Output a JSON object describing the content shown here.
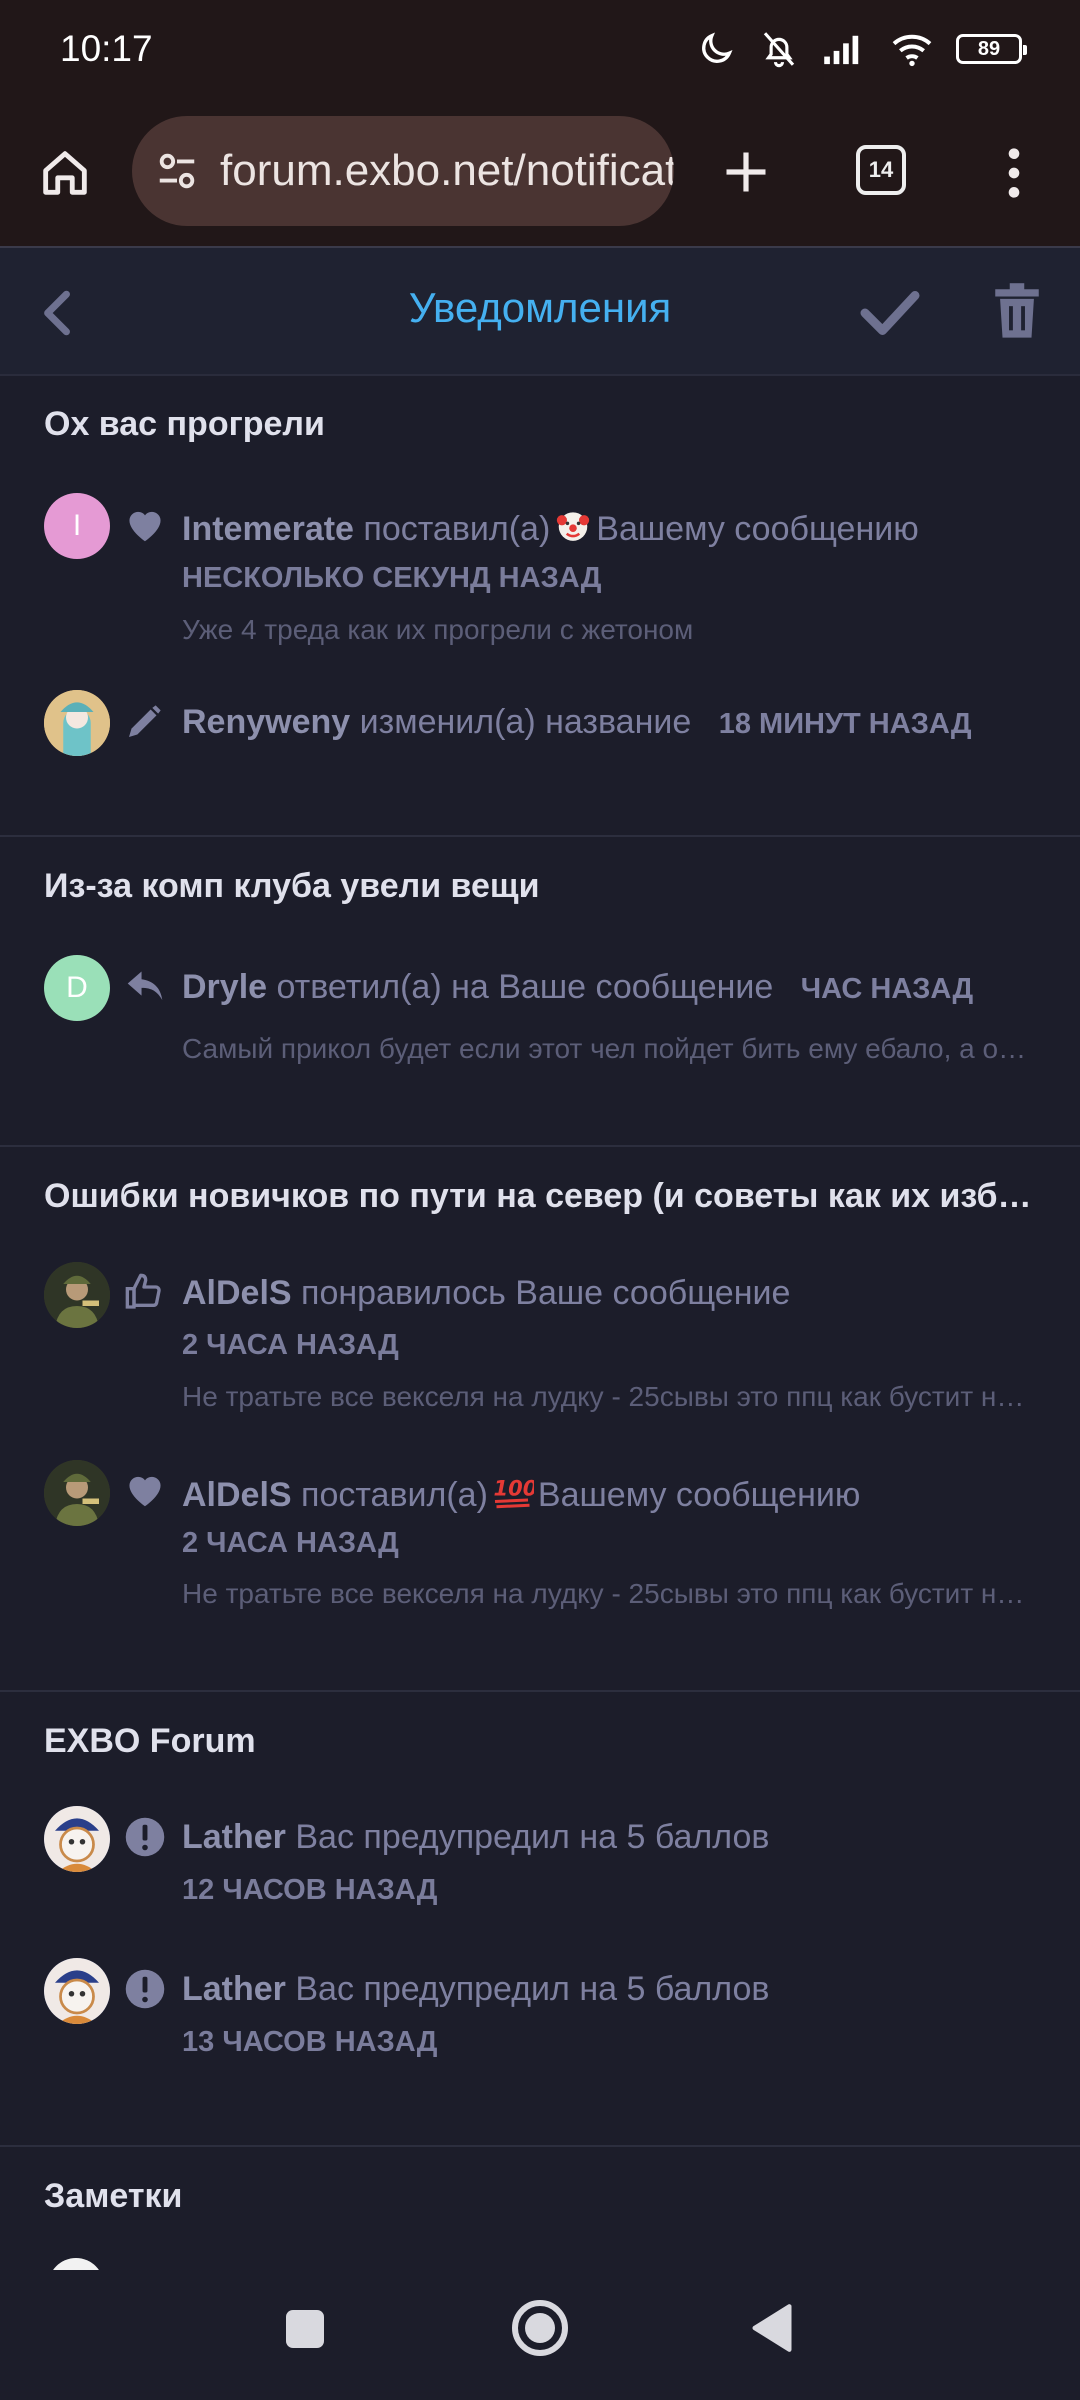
{
  "status_bar": {
    "time": "10:17",
    "battery": "89"
  },
  "browser": {
    "url": "forum.exbo.net/notifications",
    "tab_count": "14"
  },
  "header": {
    "title": "Уведомления"
  },
  "groups": [
    {
      "title": "Ох вас прогрели",
      "items": [
        {
          "user": "Intemerate",
          "action_before": "поставил(а)",
          "emoji": "clown",
          "action_after": "Вашему сообщению",
          "time": "НЕСКОЛЬКО СЕКУНД НАЗАД",
          "excerpt": "Уже 4 треда как их прогрели с жетоном",
          "icon": "heart-icon",
          "avatar_letter": "I",
          "avatar_color": "#e59ad4"
        },
        {
          "user": "Renyweny",
          "action": "изменил(а) название",
          "time": "18 МИНУТ НАЗАД",
          "icon": "pencil-icon"
        }
      ]
    },
    {
      "title": "Из-за комп клуба увели вещи",
      "items": [
        {
          "user": "Dryle",
          "action": "ответил(а) на Ваше сообщение",
          "time": "ЧАС НАЗАД",
          "excerpt": "Самый прикол будет если этот чел пойдет бить ему ебало, а он окажется каким-нибудь",
          "icon": "reply-icon",
          "avatar_letter": "D",
          "avatar_color": "#9ae0b8"
        }
      ]
    },
    {
      "title": "Ошибки новичков по пути на север (и советы как их избежать)",
      "items": [
        {
          "user": "AlDelS",
          "action": "понравилось Ваше сообщение",
          "time": "2 ЧАСА НАЗАД",
          "excerpt": "Не тратьте все векселя на лудку - 25сывы это ппц как бустит на старте",
          "icon": "thumbs-up-icon"
        },
        {
          "user": "AlDelS",
          "action_before": "поставил(а)",
          "emoji": "hundred",
          "action_after": "Вашему сообщению",
          "time": "2 ЧАСА НАЗАД",
          "excerpt": "Не тратьте все векселя на лудку - 25сывы это ппц как бустит на старте",
          "icon": "heart-icon"
        }
      ]
    },
    {
      "title": "EXBO Forum",
      "items": [
        {
          "user": "Lather",
          "action": "Вас предупредил на 5 баллов",
          "time": "12 ЧАСОВ НАЗАД",
          "icon": "exclamation-icon"
        },
        {
          "user": "Lather",
          "action": "Вас предупредил на 5 баллов",
          "time": "13 ЧАСОВ НАЗАД",
          "icon": "exclamation-icon"
        }
      ]
    },
    {
      "title": "Заметки"
    }
  ],
  "colors": {
    "accent": "#45b0f0",
    "background": "#1c1d2a",
    "header_bg": "#1f2231",
    "chrome_bg": "#211718"
  }
}
